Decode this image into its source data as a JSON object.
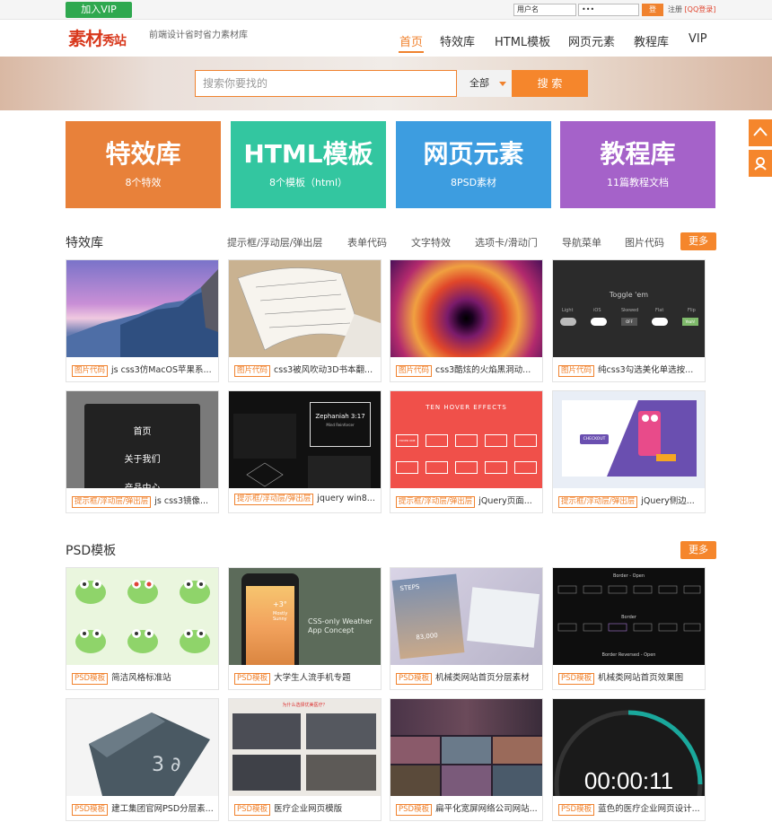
{
  "topbar": {
    "vip_label": "加入VIP",
    "username_placeholder": "用户名",
    "password_value": "•••",
    "login_label": "登",
    "register_label": "注册",
    "qq_login_label": "[QQ登录]"
  },
  "header": {
    "logo_main": "素材",
    "logo_second": "秀站",
    "slogan": "前端设计省时省力素材库",
    "nav": [
      "首页",
      "特效库",
      "HTML模板",
      "网页元素",
      "教程库",
      "VIP"
    ],
    "active_nav": "首页"
  },
  "search": {
    "placeholder": "搜索你要找的",
    "category": "全部",
    "button_label": "搜 索"
  },
  "categories": [
    {
      "title": "特效库",
      "subtitle": "8个特效",
      "color": "#e8813a"
    },
    {
      "title": "HTML模板",
      "subtitle": "8个模板（html）",
      "color": "#33c6a0"
    },
    {
      "title": "网页元素",
      "subtitle": "8PSD素材",
      "color": "#3d9de0"
    },
    {
      "title": "教程库",
      "subtitle": "11篇教程文档",
      "color": "#a562c9"
    }
  ],
  "effects": {
    "title": "特效库",
    "tabs": [
      "提示框/浮动层/弹出层",
      "表单代码",
      "文字特效",
      "选项卡/滑动门",
      "导航菜单",
      "图片代码"
    ],
    "more_label": "更多",
    "items": [
      {
        "tag": "图片代码",
        "title": "js css3仿MacOS苹果系..."
      },
      {
        "tag": "图片代码",
        "title": "css3被风吹动3D书本翻..."
      },
      {
        "tag": "图片代码",
        "title": "css3酷炫的火焰黑洞动..."
      },
      {
        "tag": "图片代码",
        "title": "纯css3勾选美化单选按..."
      },
      {
        "tag": "提示框/浮动层/弹出层",
        "title": "js css3镜像..."
      },
      {
        "tag": "提示框/浮动层/弹出层",
        "title": "jquery win8..."
      },
      {
        "tag": "提示框/浮动层/弹出层",
        "title": "jQuery页面..."
      },
      {
        "tag": "提示框/浮动层/弹出层",
        "title": "jQuery侧边..."
      }
    ],
    "thumb_text": {
      "toggle_title": "Toggle 'em",
      "toggles": [
        "Light",
        "iOS",
        "Skewed",
        "Flat",
        "Flip"
      ],
      "off": "OFF",
      "yeah": "Yeah!",
      "menu": [
        "首页",
        "关于我们",
        "产品中心"
      ],
      "zephaniah": "Zephaniah 3:17",
      "zeph_sub": "Mind Reinforcer",
      "hover_title": "TEN HOVER EFFECTS",
      "hover_btn": "HOVER ONE",
      "checkout": "CHECKOUT"
    }
  },
  "psd": {
    "title": "PSD模板",
    "more_label": "更多",
    "items": [
      {
        "tag": "PSD模板",
        "title": "简洁风格标准站"
      },
      {
        "tag": "PSD模板",
        "title": "大学生人流手机专题"
      },
      {
        "tag": "PSD模板",
        "title": "机械类网站首页分层素材"
      },
      {
        "tag": "PSD模板",
        "title": "机械类网站首页效果图"
      },
      {
        "tag": "PSD模板",
        "title": "建工集团官网PSD分层素..."
      },
      {
        "tag": "PSD模板",
        "title": "医疗企业网页模版"
      },
      {
        "tag": "PSD模板",
        "title": "扁平化宽屏网络公司网站..."
      },
      {
        "tag": "PSD模板",
        "title": "蓝色的医疗企业网页设计..."
      }
    ],
    "thumb_text": {
      "weather_title": "CSS-only Weather App Concept",
      "weather_temp": "+3°",
      "weather_day": "Mostly Sunny",
      "steps": "STEPS",
      "steps_num": "83,000",
      "border_open": "Border - Open",
      "border_mid": "Border",
      "border_reversed": "Border Reversed - Open",
      "doctor_title": "为什么选择优美医疗？",
      "timer": "00:00:11"
    }
  }
}
